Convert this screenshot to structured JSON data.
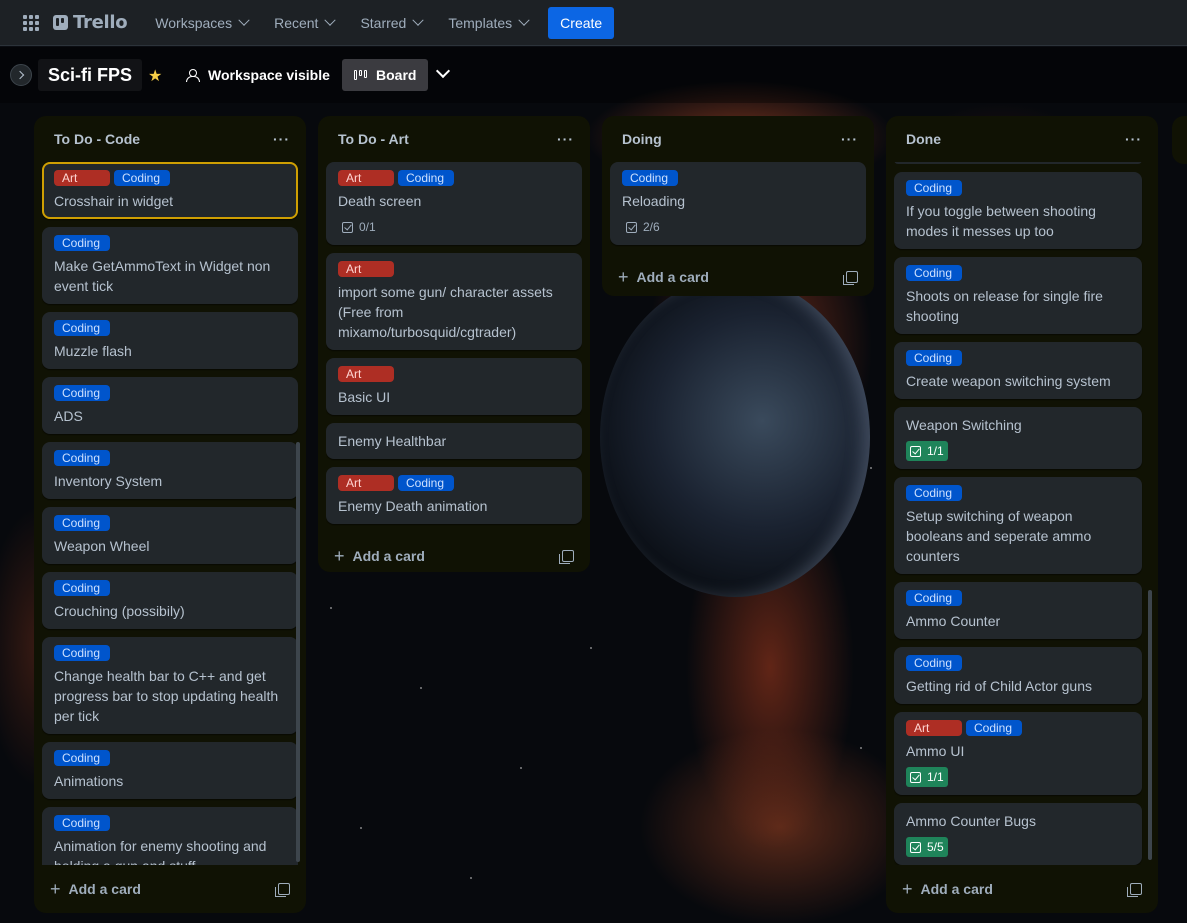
{
  "nav": {
    "logo": "Trello",
    "menus": [
      "Workspaces",
      "Recent",
      "Starred",
      "Templates"
    ],
    "create": "Create"
  },
  "board": {
    "title": "Sci-fi FPS",
    "visibility": "Workspace visible",
    "view": "Board"
  },
  "colors": {
    "art_label": "#ae2e24",
    "coding_label": "#0055cc",
    "checklist_complete": "#1f845a",
    "selected_outline": "#cf9f02"
  },
  "lists": [
    {
      "title": "To Do - Code",
      "menu": "···",
      "add_card": "Add a card",
      "cards": [
        {
          "labels": [
            "Art",
            "Coding"
          ],
          "title": "Crosshair in widget"
        },
        {
          "labels": [
            "Coding"
          ],
          "title": "Make GetAmmoText in Widget non event tick"
        },
        {
          "labels": [
            "Coding"
          ],
          "title": "Muzzle flash"
        },
        {
          "labels": [
            "Coding"
          ],
          "title": "ADS"
        },
        {
          "labels": [
            "Coding"
          ],
          "title": "Inventory System"
        },
        {
          "labels": [
            "Coding"
          ],
          "title": "Weapon Wheel"
        },
        {
          "labels": [
            "Coding"
          ],
          "title": "Crouching (possibily)"
        },
        {
          "labels": [
            "Coding"
          ],
          "title": "Change health bar to C++ and get progress bar to stop updating health per tick"
        },
        {
          "labels": [
            "Coding"
          ],
          "title": "Animations"
        },
        {
          "labels": [
            "Coding"
          ],
          "title": "Animation for enemy shooting and holding a gun and stuff"
        }
      ]
    },
    {
      "title": "To Do - Art",
      "menu": "···",
      "add_card": "Add a card",
      "cards": [
        {
          "labels": [
            "Art",
            "Coding"
          ],
          "title": "Death screen",
          "checklist": "0/1"
        },
        {
          "labels": [
            "Art"
          ],
          "title": "import some gun/ character assets (Free from mixamo/turbosquid/cgtrader)"
        },
        {
          "labels": [
            "Art"
          ],
          "title": "Basic UI"
        },
        {
          "labels": [],
          "title": "Enemy Healthbar"
        },
        {
          "labels": [
            "Art",
            "Coding"
          ],
          "title": "Enemy Death animation"
        }
      ]
    },
    {
      "title": "Doing",
      "menu": "···",
      "add_card": "Add a card",
      "cards": [
        {
          "labels": [
            "Coding"
          ],
          "title": "Reloading",
          "checklist": "2/6"
        }
      ]
    },
    {
      "title": "Done",
      "menu": "···",
      "add_card": "Add a card",
      "cards": [
        {
          "labels": [
            "Coding"
          ],
          "title": "If you toggle between shooting modes it messes up too"
        },
        {
          "labels": [
            "Coding"
          ],
          "title": "Shoots on release for single fire shooting"
        },
        {
          "labels": [
            "Coding"
          ],
          "title": "Create weapon switching system"
        },
        {
          "labels": [],
          "title": "Weapon Switching",
          "checklist": "1/1",
          "checklist_done": true
        },
        {
          "labels": [
            "Coding"
          ],
          "title": "Setup switching of weapon booleans and seperate ammo counters"
        },
        {
          "labels": [
            "Coding"
          ],
          "title": "Ammo Counter"
        },
        {
          "labels": [
            "Coding"
          ],
          "title": "Getting rid of Child Actor guns"
        },
        {
          "labels": [
            "Art",
            "Coding"
          ],
          "title": "Ammo UI",
          "checklist": "1/1",
          "checklist_done": true
        },
        {
          "labels": [],
          "title": "Ammo Counter Bugs",
          "checklist": "5/5",
          "checklist_done": true
        }
      ]
    }
  ]
}
